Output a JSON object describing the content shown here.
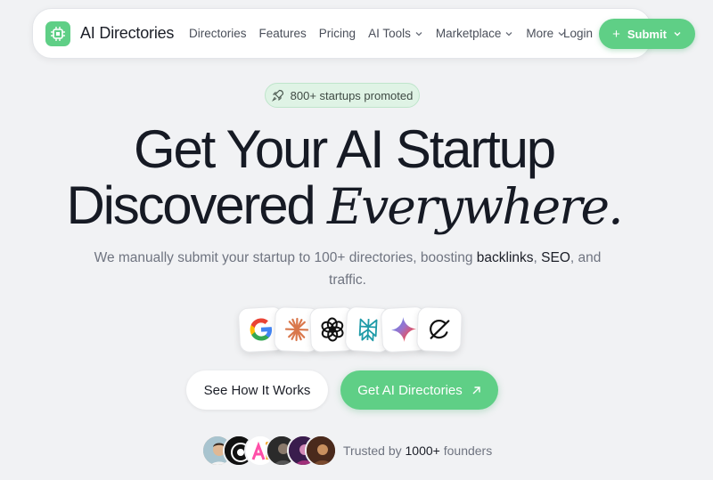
{
  "nav": {
    "brand": "AI Directories",
    "items": [
      {
        "label": "Directories",
        "dropdown": false
      },
      {
        "label": "Features",
        "dropdown": false
      },
      {
        "label": "Pricing",
        "dropdown": false
      },
      {
        "label": "AI Tools",
        "dropdown": true
      },
      {
        "label": "Marketplace",
        "dropdown": true
      },
      {
        "label": "More",
        "dropdown": true
      }
    ],
    "login": "Login",
    "submit": "Submit"
  },
  "badge": {
    "text": "800+ startups promoted",
    "icon": "rocket-icon"
  },
  "hero": {
    "line1": "Get Your AI Startup",
    "line2_plain": "Discovered",
    "line2_accent": "Everywhere."
  },
  "subtitle": {
    "part1": "We manually submit your startup to 100+ directories, boosting ",
    "hl1": "backlinks",
    "part2": ", ",
    "hl2": "SEO",
    "part3": ", and",
    "part4": "traffic."
  },
  "logos": [
    "google-icon",
    "claude-icon",
    "openai-icon",
    "perplexity-icon",
    "gemini-icon",
    "grok-icon"
  ],
  "cta": {
    "secondary": "See How It Works",
    "primary": "Get AI Directories",
    "primary_icon": "arrow-up-right-icon"
  },
  "social_proof": {
    "prefix": "Trusted by ",
    "count": "1000+",
    "suffix": " founders"
  },
  "colors": {
    "accent": "#5fcf86",
    "background": "#f1f2f4",
    "text": "#161a24",
    "muted": "#6f7480"
  }
}
